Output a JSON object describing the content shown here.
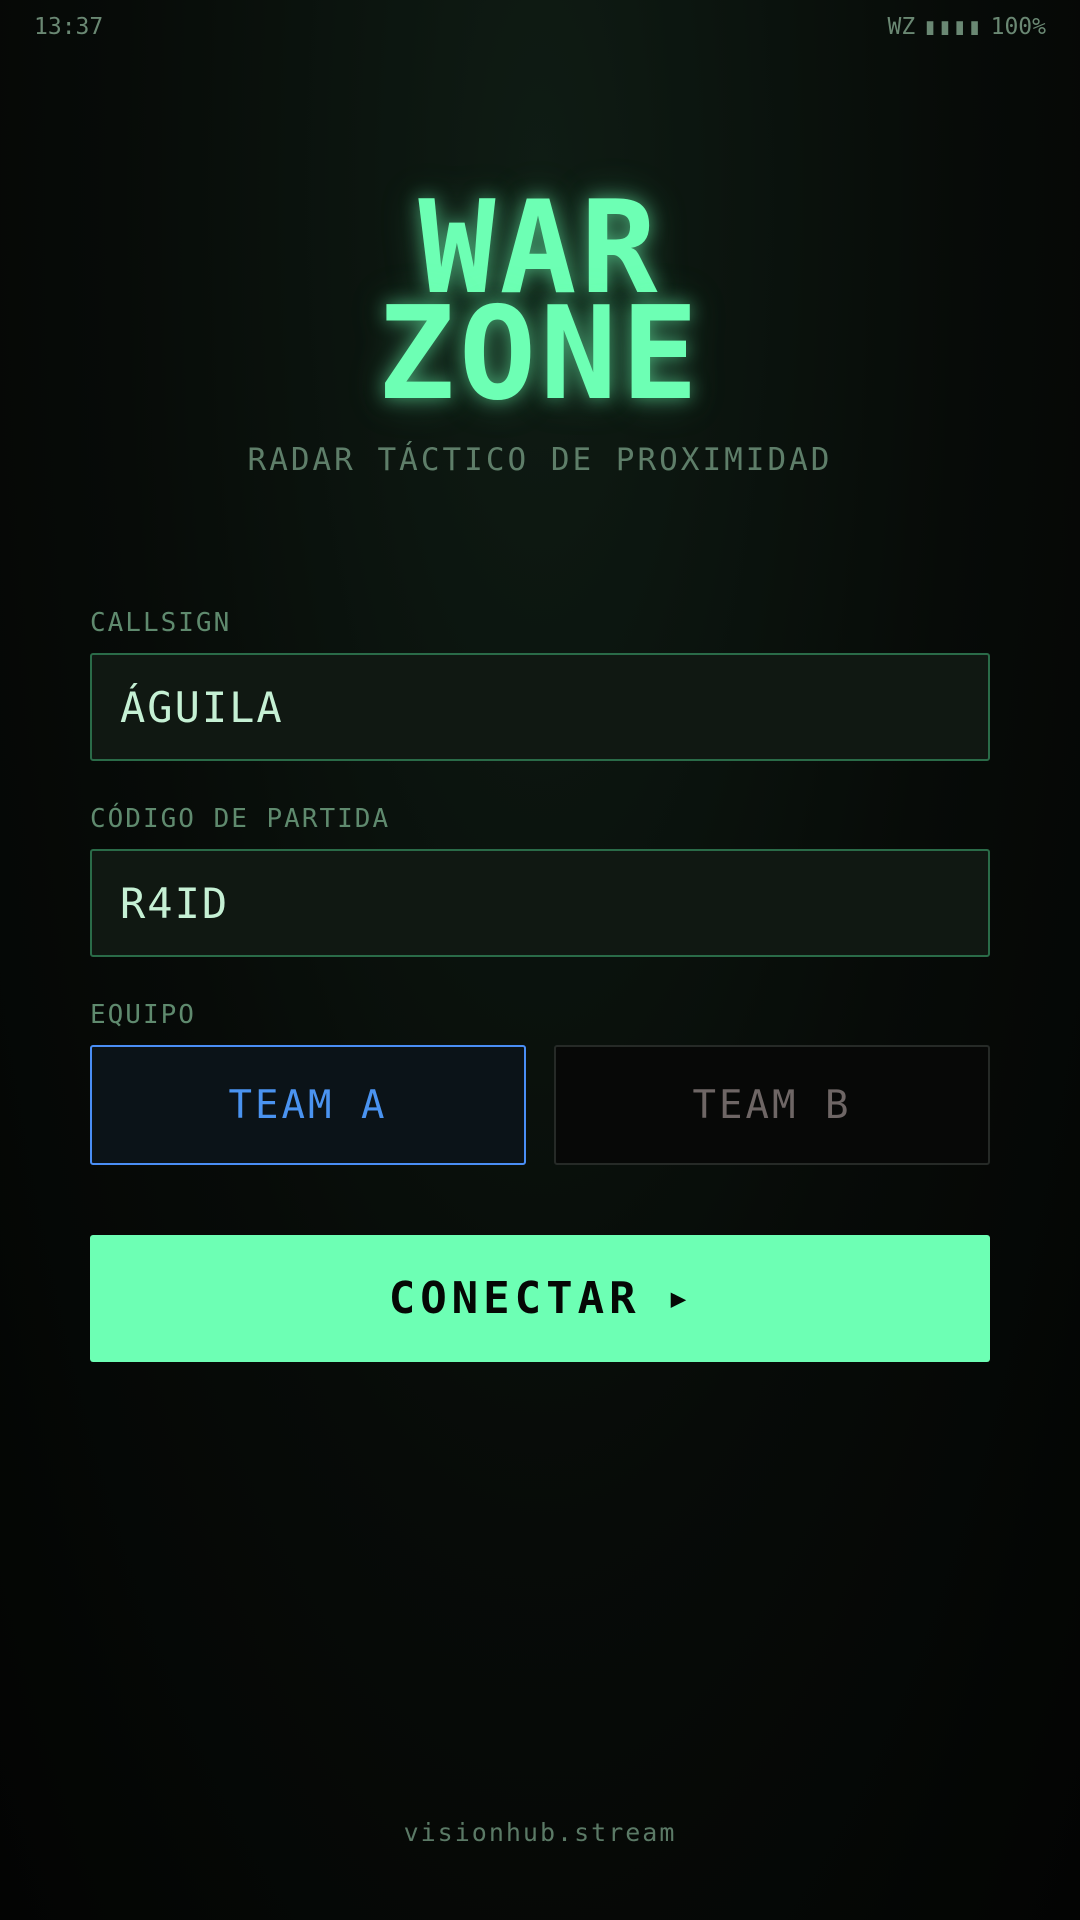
{
  "status_bar": {
    "time": "13:37",
    "carrier": "WZ",
    "signal": "▮▮▮▮",
    "battery": "100%"
  },
  "header": {
    "title_line1": "WAR",
    "title_line2": "ZONE",
    "subtitle": "RADAR TÁCTICO DE PROXIMIDAD"
  },
  "form": {
    "callsign_label": "CALLSIGN",
    "callsign_value": "ÁGUILA",
    "game_code_label": "CÓDIGO DE PARTIDA",
    "game_code_value": "R4ID",
    "team_label": "EQUIPO",
    "teams": [
      {
        "label": "TEAM A",
        "selected": true
      },
      {
        "label": "TEAM B",
        "selected": false
      }
    ],
    "connect_label": "CONECTAR",
    "connect_icon": "▶"
  },
  "footer": {
    "text": "visionhub.stream"
  },
  "colors": {
    "accent": "#6dffb4",
    "team_a": "#4a93f0",
    "team_b": "#6e6665",
    "background": "#070b08"
  }
}
